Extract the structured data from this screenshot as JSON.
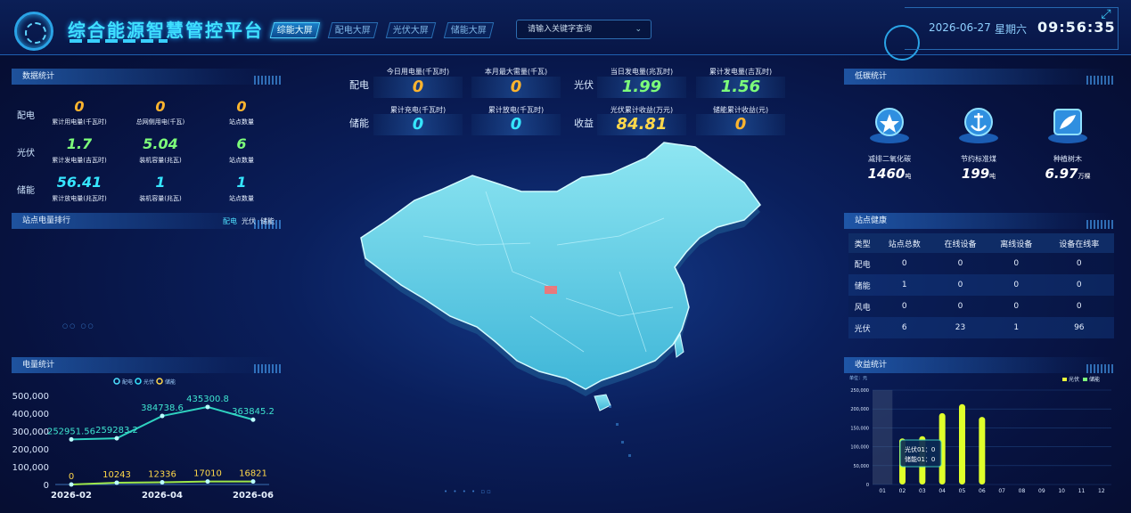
{
  "header": {
    "title": "综合能源智慧管控平台",
    "tabs": [
      {
        "label": "综能大屏"
      },
      {
        "label": "配电大屏"
      },
      {
        "label": "光伏大屏"
      },
      {
        "label": "储能大屏"
      }
    ],
    "search_placeholder": "请输入关键字查询",
    "date": "2026-06-27",
    "weekday": "星期六",
    "time": "09:56:35"
  },
  "data_stats": {
    "title": "数据统计",
    "rows": [
      {
        "label": "配电",
        "items": [
          {
            "value": "0",
            "label": "累计用电量(千瓦时)"
          },
          {
            "value": "0",
            "label": "总网侧用电(千瓦)"
          },
          {
            "value": "0",
            "label": "站点数量"
          }
        ]
      },
      {
        "label": "光伏",
        "items": [
          {
            "value": "1.7",
            "label": "累计发电量(吉瓦时)"
          },
          {
            "value": "5.04",
            "label": "装机容量(兆瓦)"
          },
          {
            "value": "6",
            "label": "站点数量"
          }
        ]
      },
      {
        "label": "储能",
        "items": [
          {
            "value": "56.41",
            "label": "累计放电量(兆瓦时)"
          },
          {
            "value": "1",
            "label": "装机容量(兆瓦)"
          },
          {
            "value": "1",
            "label": "站点数量"
          }
        ]
      }
    ]
  },
  "rank": {
    "title": "站点电量排行",
    "tabs": [
      "配电",
      "光伏",
      "储能"
    ]
  },
  "energy_stats": {
    "title": "电量统计",
    "legend": [
      "配电",
      "光伏",
      "储能"
    ]
  },
  "top_metrics": {
    "dist_label": "配电",
    "pv_label": "光伏",
    "storage_label": "储能",
    "income_label": "收益",
    "dist": [
      {
        "label": "今日用电量(千瓦时)",
        "value": "0"
      },
      {
        "label": "本月最大需量(千瓦)",
        "value": "0"
      }
    ],
    "pv": [
      {
        "label": "当日发电量(兆瓦时)",
        "value": "1.99"
      },
      {
        "label": "累计发电量(吉瓦时)",
        "value": "1.56"
      }
    ],
    "storage": [
      {
        "label": "累计充电(千瓦时)",
        "value": "0"
      },
      {
        "label": "累计放电(千瓦时)",
        "value": "0"
      }
    ],
    "income": [
      {
        "label": "光伏累计收益(万元)",
        "value": "84.81"
      },
      {
        "label": "储能累计收益(元)",
        "value": "0"
      }
    ]
  },
  "low_carbon": {
    "title": "低碳统计",
    "items": [
      {
        "label": "减排二氧化碳",
        "value": "1460",
        "unit": "吨"
      },
      {
        "label": "节约标准煤",
        "value": "199",
        "unit": "吨"
      },
      {
        "label": "种植树木",
        "value": "6.97",
        "unit": "万棵"
      }
    ]
  },
  "health": {
    "title": "站点健康",
    "headers": [
      "类型",
      "站点总数",
      "在线设备",
      "离线设备",
      "设备在线率"
    ],
    "rows": [
      [
        "配电",
        "0",
        "0",
        "0",
        "0"
      ],
      [
        "储能",
        "1",
        "0",
        "0",
        "0"
      ],
      [
        "风电",
        "0",
        "0",
        "0",
        "0"
      ],
      [
        "光伏",
        "6",
        "23",
        "1",
        "96"
      ]
    ]
  },
  "income_stats": {
    "title": "收益统计",
    "unit": "单位：元",
    "legend": [
      "光伏",
      "储能"
    ],
    "tooltip": [
      "光伏01：0",
      "储能01：0"
    ]
  },
  "colors": {
    "accent": "#3fe0ff",
    "orange": "#ffb52e",
    "green": "#7dff7a",
    "cyan": "#36e6ff",
    "yellow": "#e8ff3a"
  },
  "chart_data": [
    {
      "type": "line",
      "title": "电量统计",
      "x": [
        "2026-02",
        "2026-03",
        "2026-04",
        "2026-05",
        "2026-06"
      ],
      "xticks": [
        "2026-02",
        "2026-04",
        "2026-06"
      ],
      "ylim": [
        0,
        500000
      ],
      "yticks": [
        "500,000",
        "400,000",
        "300,000",
        "200,000",
        "100,000",
        "0"
      ],
      "series": [
        {
          "name": "光伏",
          "values": [
            252951.56,
            259283.2,
            384738.6,
            435300.8,
            363845.2
          ],
          "labels": [
            "252951.56",
            "259283.2",
            "384738.6",
            "435300.8",
            "363845.2"
          ]
        },
        {
          "name": "储能",
          "values": [
            0,
            10243,
            12336,
            17010,
            16821
          ],
          "labels": [
            "0",
            "10243",
            "12336",
            "17010",
            "16821"
          ]
        }
      ]
    },
    {
      "type": "bar",
      "title": "收益统计",
      "categories": [
        "01",
        "02",
        "03",
        "04",
        "05",
        "06",
        "07",
        "08",
        "09",
        "10",
        "11",
        "12"
      ],
      "ylim": [
        0,
        250000
      ],
      "yticks": [
        "250,000",
        "200,000",
        "150,000",
        "100,000",
        "50,000",
        "0"
      ],
      "series": [
        {
          "name": "光伏",
          "values": [
            0,
            122000,
            128000,
            189000,
            213000,
            179000,
            0,
            0,
            0,
            0,
            0,
            0
          ]
        },
        {
          "name": "储能",
          "values": [
            0,
            0,
            0,
            0,
            0,
            0,
            0,
            0,
            0,
            0,
            0,
            0
          ]
        }
      ]
    }
  ]
}
